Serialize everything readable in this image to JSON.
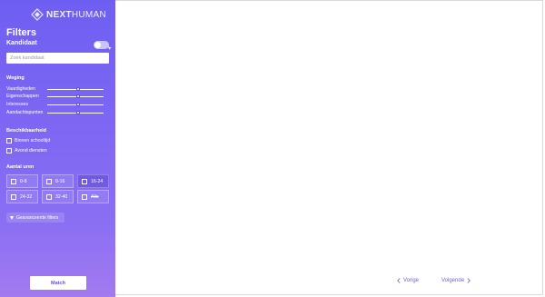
{
  "brand": {
    "prefix": "NEXT",
    "suffix": "HUMAN"
  },
  "sidebar": {
    "title": "Filters",
    "kandidaat": {
      "label": "Kandidaat",
      "toggle_on": false
    },
    "search": {
      "placeholder": "Zoek kandidaat",
      "value": ""
    },
    "weging": {
      "heading": "Weging",
      "sliders": [
        {
          "label": "Vaardigheden",
          "value": 0.55
        },
        {
          "label": "Eigenschappen",
          "value": 0.55
        },
        {
          "label": "Interesses",
          "value": 0.55
        },
        {
          "label": "Aandachtspunten",
          "value": 0.55
        }
      ]
    },
    "beschikbaarheid": {
      "heading": "Beschikbaarheid",
      "options": [
        {
          "label": "Binnen schooltijd",
          "checked": false
        },
        {
          "label": "Avond diensten",
          "checked": false
        }
      ]
    },
    "aantal_uren": {
      "heading": "Aantal uren",
      "options": [
        {
          "label": "0-8",
          "checked": false
        },
        {
          "label": "8-16",
          "checked": false
        },
        {
          "label": "16-24",
          "checked": false
        },
        {
          "label": "24-32",
          "checked": false
        },
        {
          "label": "32-40",
          "checked": false
        },
        {
          "label": "Alle",
          "checked": false
        }
      ]
    },
    "advanced_label": "Geavanceerde filters",
    "match_label": "Match"
  },
  "pagination": {
    "prev_label": "Vorige",
    "next_label": "Volgende"
  },
  "colors": {
    "accent": "#6f5ff2",
    "sidebar_bottom": "#a37af0",
    "link": "#6f63d6"
  }
}
